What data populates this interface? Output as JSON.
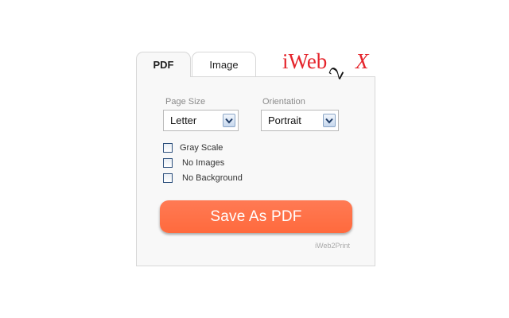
{
  "tabs": [
    {
      "label": "PDF",
      "active": true
    },
    {
      "label": "Image",
      "active": false
    }
  ],
  "logo": {
    "text_left": "iWeb",
    "text_mid": "2",
    "text_right": "X",
    "color_main": "#e5242b",
    "color_mid": "#111111"
  },
  "form": {
    "page_size": {
      "label": "Page Size",
      "value": "Letter"
    },
    "orientation": {
      "label": "Orientation",
      "value": "Portrait"
    },
    "options": [
      {
        "label": "Gray Scale",
        "checked": false
      },
      {
        "label": "No Images",
        "checked": false
      },
      {
        "label": "No Background",
        "checked": false
      }
    ]
  },
  "save_button": {
    "label": "Save As PDF",
    "color": "#ff6f47"
  },
  "footer": {
    "brand": "iWeb2Print"
  },
  "icons": {
    "dropdown": "chevron-down-icon"
  }
}
